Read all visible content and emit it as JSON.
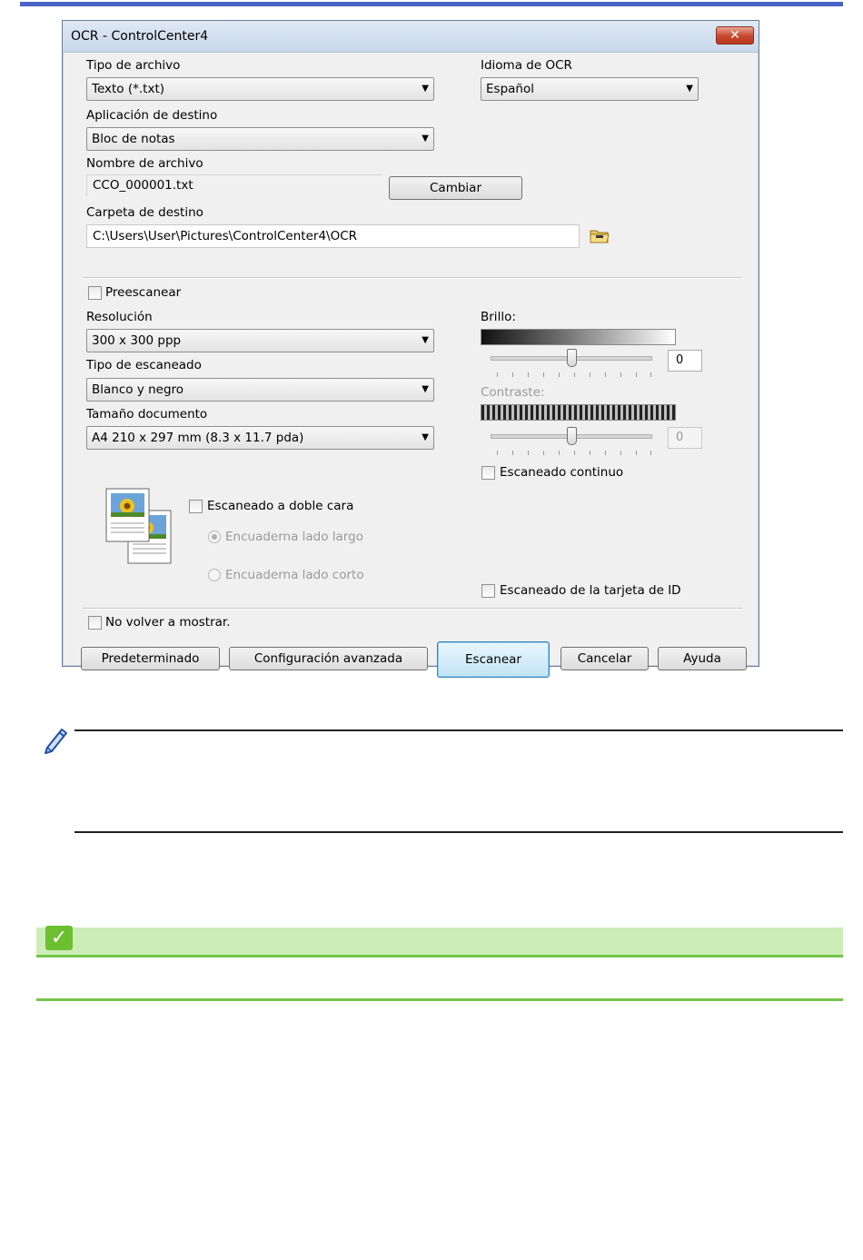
{
  "dialog": {
    "title": "OCR - ControlCenter4",
    "close_glyph": "✕",
    "file_type": {
      "label": "Tipo de archivo",
      "value": "Texto (*.txt)"
    },
    "ocr_language": {
      "label": "Idioma de OCR",
      "value": "Español"
    },
    "target_app": {
      "label": "Aplicación de destino",
      "value": "Bloc de notas"
    },
    "file_name": {
      "label": "Nombre de archivo",
      "value": "CCO_000001.txt",
      "change_label": "Cambiar"
    },
    "dest_folder": {
      "label": "Carpeta de destino",
      "value": "C:\\Users\\User\\Pictures\\ControlCenter4\\OCR"
    },
    "prescan_label": "Preescanear",
    "resolution": {
      "label": "Resolución",
      "value": "300 x 300 ppp"
    },
    "scan_type": {
      "label": "Tipo de escaneado",
      "value": "Blanco y negro"
    },
    "doc_size": {
      "label": "Tamaño documento",
      "value": "A4 210 x 297 mm (8.3 x 11.7 pda)"
    },
    "brightness": {
      "label": "Brillo:",
      "value": "0"
    },
    "contrast": {
      "label": "Contraste:",
      "value": "0"
    },
    "continuous_label": "Escaneado continuo",
    "duplex": {
      "label": "Escaneado a doble cara",
      "long_edge": "Encuaderna lado largo",
      "short_edge": "Encuaderna lado corto"
    },
    "id_card_label": "Escaneado de la tarjeta de ID",
    "dont_show_label": "No volver a mostrar.",
    "buttons": {
      "default": "Predeterminado",
      "advanced": "Configuración avanzada",
      "scan": "Escanear",
      "cancel": "Cancelar",
      "help": "Ayuda"
    },
    "dropdown_arrow": "▼"
  },
  "colors": {
    "accent_bar": "#4a63c8",
    "related_strip": "#ccedb8",
    "related_rule": "#74c44a",
    "check_icon": "#6cbf2e"
  },
  "icons": [
    "close-icon",
    "folder-icon",
    "duplex-documents-icon",
    "pencil-note-icon",
    "checkmark-icon"
  ]
}
